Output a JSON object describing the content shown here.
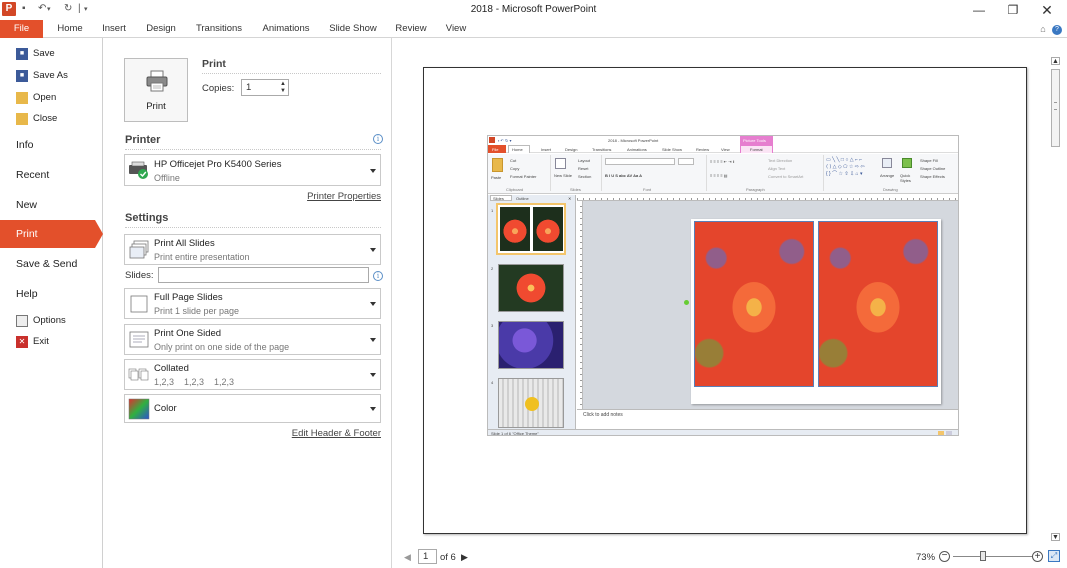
{
  "titlebar": {
    "title": "2018  -  Microsoft PowerPoint",
    "logo_letter": "P"
  },
  "tabs": [
    "File",
    "Home",
    "Insert",
    "Design",
    "Transitions",
    "Animations",
    "Slide Show",
    "Review",
    "View"
  ],
  "nav": {
    "save": "Save",
    "save_as": "Save As",
    "open": "Open",
    "close": "Close",
    "info": "Info",
    "recent": "Recent",
    "new": "New",
    "print": "Print",
    "save_send": "Save & Send",
    "help": "Help",
    "options": "Options",
    "exit": "Exit"
  },
  "print": {
    "section_title": "Print",
    "button_label": "Print",
    "copies_label": "Copies:",
    "copies_value": "1"
  },
  "printer": {
    "section_title": "Printer",
    "name": "HP Officejet Pro K5400 Series",
    "status": "Offline",
    "properties_link": "Printer Properties"
  },
  "settings": {
    "section_title": "Settings",
    "range_main": "Print All Slides",
    "range_sub": "Print entire presentation",
    "slides_label": "Slides:",
    "slides_value": "",
    "layout_main": "Full Page Slides",
    "layout_sub": "Print 1 slide per page",
    "sides_main": "Print One Sided",
    "sides_sub": "Only print on one side of the page",
    "collate_main": "Collated",
    "collate_sub": "1,2,3    1,2,3    1,2,3",
    "color_main": "Color",
    "header_footer_link": "Edit Header & Footer"
  },
  "preview": {
    "page_current": "1",
    "page_total": "of 6",
    "zoom": "73%"
  },
  "mini": {
    "title": "2018 - Microsoft PowerPoint",
    "context_tab": "Picture Tools",
    "tabs": [
      "File",
      "Home",
      "Insert",
      "Design",
      "Transitions",
      "Animations",
      "Slide Show",
      "Review",
      "View",
      "Format"
    ],
    "groups": [
      "Clipboard",
      "Slides",
      "Font",
      "Paragraph",
      "Drawing"
    ],
    "pane_tabs": [
      "Slides",
      "Outline"
    ],
    "notes": "Click to add notes",
    "status": "Slide 1 of 6    \"Office Theme\"",
    "slide_nums": [
      "1",
      "2",
      "3",
      "4"
    ],
    "buttons": {
      "cut": "Cut",
      "copy": "Copy",
      "format_painter": "Format Painter",
      "paste": "Paste",
      "new_slide": "New Slide",
      "layout": "Layout",
      "reset": "Reset",
      "section": "Section",
      "text_direction": "Text Direction",
      "align_text": "Align Text",
      "convert_smartart": "Convert to SmartArt",
      "arrange": "Arrange",
      "quick_styles": "Quick Styles",
      "shape_fill": "Shape Fill",
      "shape_outline": "Shape Outline",
      "shape_effects": "Shape Effects"
    }
  },
  "colors": {
    "accent": "#e3502b",
    "link_blue": "#5b8fc7"
  }
}
